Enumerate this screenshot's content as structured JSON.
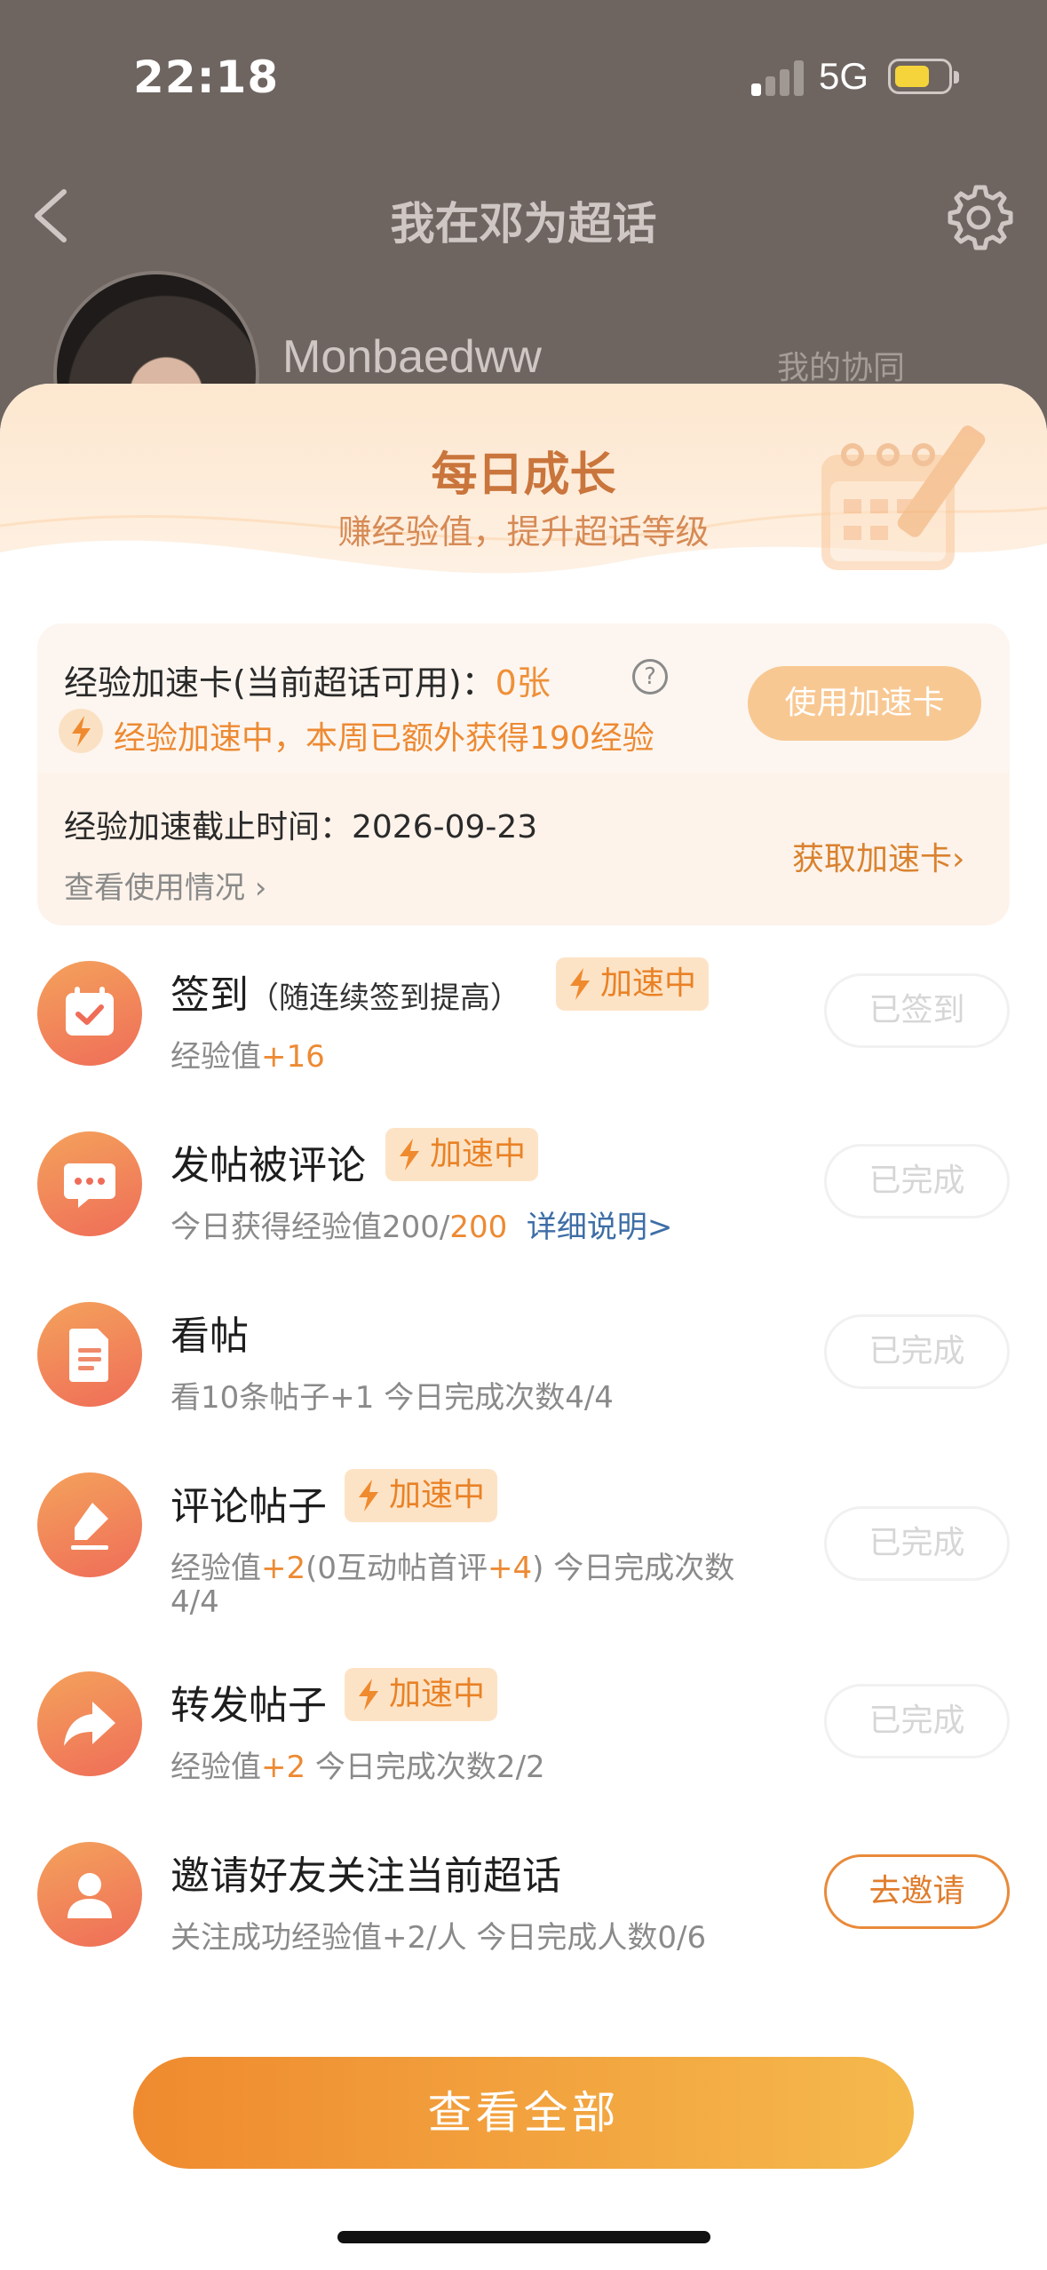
{
  "status_bar": {
    "time": "22:18",
    "network": "5G"
  },
  "header": {
    "title": "我在邓为超话",
    "username": "Monbaedww",
    "dim_text": "我的协同"
  },
  "daily": {
    "title": "每日成长",
    "subtitle": "赚经验值，提升超话等级"
  },
  "boost_card": {
    "label_prefix": "经验加速卡(当前超话可用)：",
    "count": "0张",
    "help": "?",
    "use_button": "使用加速卡",
    "status": "经验加速中，本周已额外获得190经验",
    "deadline": "经验加速截止时间：2026-09-23",
    "usage_link": "查看使用情况 ›",
    "get_link": "获取加速卡›"
  },
  "tag_label": "加速中",
  "tasks": [
    {
      "name": "签到",
      "note": "（随连续签到提高）",
      "desc_prefix": "经验值",
      "desc_accent": "+16",
      "button": "已签到"
    },
    {
      "name": "发帖被评论",
      "desc_prefix": "今日获得经验值200/",
      "desc_accent": "200",
      "desc_link": "详细说明>",
      "button": "已完成"
    },
    {
      "name": "看帖",
      "desc": "看10条帖子+1  今日完成次数4/4",
      "button": "已完成"
    },
    {
      "name": "评论帖子",
      "desc_a": "经验值",
      "desc_b": "+2",
      "desc_c": "(0互动帖首评",
      "desc_d": "+4",
      "desc_e": ")  今日完成次数",
      "desc_line2": "4/4",
      "button": "已完成"
    },
    {
      "name": "转发帖子",
      "desc_a": "经验值",
      "desc_b": "+2",
      "desc_c": "  今日完成次数2/2",
      "button": "已完成"
    },
    {
      "name": "邀请好友关注当前超话",
      "desc": "关注成功经验值+2/人  今日完成人数0/6",
      "button": "去邀请"
    }
  ],
  "view_all": "查看全部",
  "colors": {
    "accent": "#ef8a2f",
    "tag_bg": "#fde3c6",
    "link_blue": "#3e6ea6"
  }
}
